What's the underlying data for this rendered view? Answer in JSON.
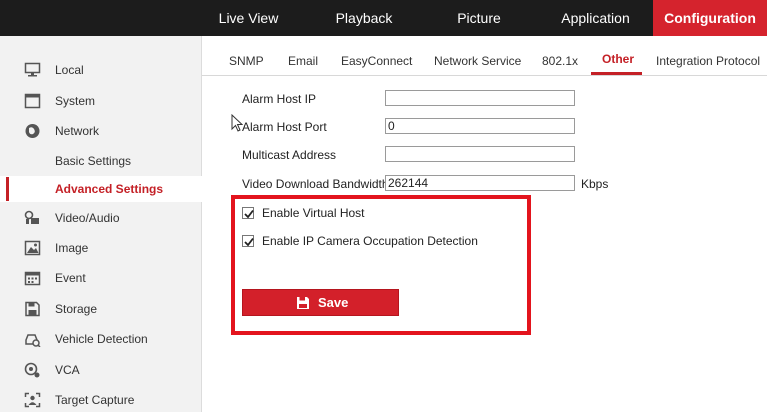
{
  "topnav": {
    "items": [
      {
        "label": "Live View"
      },
      {
        "label": "Playback"
      },
      {
        "label": "Picture"
      },
      {
        "label": "Application"
      },
      {
        "label": "Configuration"
      }
    ],
    "active": "Configuration"
  },
  "sidebar": {
    "items": [
      {
        "label": "Local",
        "icon": "monitor-icon"
      },
      {
        "label": "System",
        "icon": "system-window-icon"
      },
      {
        "label": "Network",
        "icon": "globe-icon"
      },
      {
        "label": "Basic Settings"
      },
      {
        "label": "Advanced Settings"
      },
      {
        "label": "Video/Audio",
        "icon": "video-audio-icon"
      },
      {
        "label": "Image",
        "icon": "image-icon"
      },
      {
        "label": "Event",
        "icon": "calendar-icon"
      },
      {
        "label": "Storage",
        "icon": "floppy-disk-icon"
      },
      {
        "label": "Vehicle Detection",
        "icon": "vehicle-search-icon"
      },
      {
        "label": "VCA",
        "icon": "vca-icon"
      },
      {
        "label": "Target Capture",
        "icon": "target-capture-icon"
      }
    ],
    "active": "Advanced Settings"
  },
  "tabs": {
    "items": [
      {
        "label": "SNMP"
      },
      {
        "label": "Email"
      },
      {
        "label": "EasyConnect"
      },
      {
        "label": "Network Service"
      },
      {
        "label": "802.1x"
      },
      {
        "label": "Other"
      },
      {
        "label": "Integration Protocol"
      }
    ],
    "active": "Other"
  },
  "form": {
    "alarm_host_ip": {
      "label": "Alarm Host IP",
      "value": ""
    },
    "alarm_host_port": {
      "label": "Alarm Host Port",
      "value": "0"
    },
    "multicast_address": {
      "label": "Multicast Address",
      "value": ""
    },
    "video_download_bandwidth": {
      "label": "Video Download Bandwidth",
      "value": "262144",
      "unit": "Kbps"
    },
    "enable_virtual_host": {
      "label": "Enable Virtual Host",
      "checked": true
    },
    "enable_ip_camera_occupation": {
      "label": "Enable IP Camera Occupation Detection",
      "checked": true
    },
    "save_label": "Save"
  },
  "colors": {
    "accent": "#d5232d",
    "topbar": "#1c1c1c",
    "highlight": "#e3141d"
  }
}
